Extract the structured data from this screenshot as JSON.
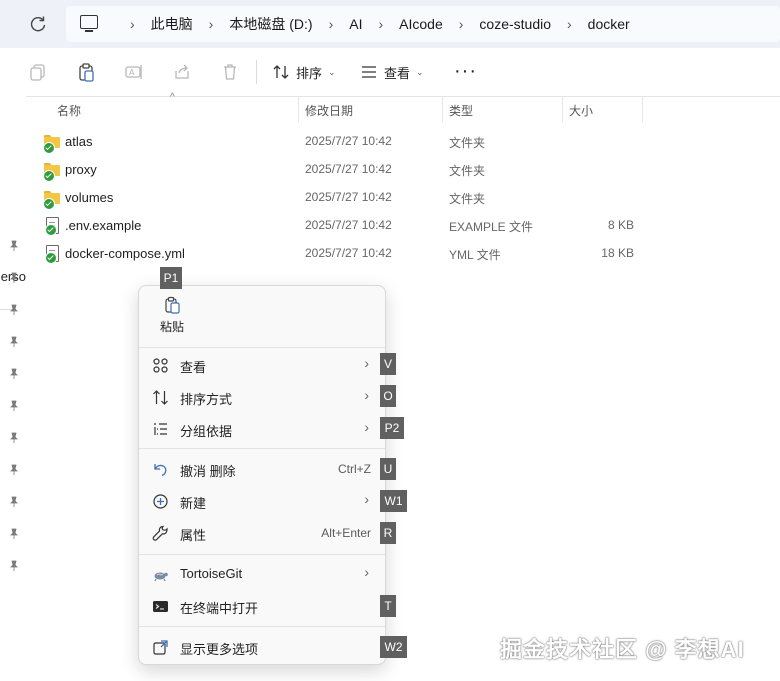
{
  "address_bar": {
    "refresh_icon": "refresh-icon",
    "pc_icon": "computer-icon",
    "crumbs": [
      "此电脑",
      "本地磁盘 (D:)",
      "AI",
      "AIcode",
      "coze-studio",
      "docker"
    ]
  },
  "toolbar": {
    "sort_label": "排序",
    "view_label": "查看",
    "more_label": "···"
  },
  "nav_pane": {
    "truncated_text": "erso"
  },
  "file_list": {
    "columns": [
      "名称",
      "修改日期",
      "类型",
      "大小"
    ],
    "rows": [
      {
        "name": "atlas",
        "date": "2025/7/27 10:42",
        "type": "文件夹",
        "size": "",
        "icon": "folder-icon"
      },
      {
        "name": "proxy",
        "date": "2025/7/27 10:42",
        "type": "文件夹",
        "size": "",
        "icon": "folder-icon"
      },
      {
        "name": "volumes",
        "date": "2025/7/27 10:42",
        "type": "文件夹",
        "size": "",
        "icon": "folder-icon"
      },
      {
        "name": ".env.example",
        "date": "2025/7/27 10:42",
        "type": "EXAMPLE 文件",
        "size": "8 KB",
        "icon": "file-icon"
      },
      {
        "name": "docker-compose.yml",
        "date": "2025/7/27 10:42",
        "type": "YML 文件",
        "size": "18 KB",
        "icon": "file-icon"
      }
    ]
  },
  "context_menu": {
    "paste_label": "粘贴",
    "items": [
      {
        "label": "查看",
        "shortcut": "",
        "icon": "grid-view-icon"
      },
      {
        "label": "排序方式",
        "shortcut": "",
        "icon": "sort-icon"
      },
      {
        "label": "分组依据",
        "shortcut": "",
        "icon": "group-by-icon"
      },
      {
        "label": "撤消 删除",
        "shortcut": "Ctrl+Z",
        "icon": "undo-icon"
      },
      {
        "label": "新建",
        "shortcut": "",
        "icon": "new-plus-icon"
      },
      {
        "label": "属性",
        "shortcut": "Alt+Enter",
        "icon": "wrench-icon"
      },
      {
        "label": "TortoiseGit",
        "shortcut": "",
        "icon": "tortoisegit-icon"
      },
      {
        "label": "在终端中打开",
        "shortcut": "",
        "icon": "terminal-icon"
      },
      {
        "label": "显示更多选项",
        "shortcut": "",
        "icon": "more-options-icon"
      }
    ]
  },
  "keytips": [
    "P1",
    "V",
    "O",
    "P2",
    "U",
    "W1",
    "R",
    "T",
    "W2"
  ],
  "watermark": "掘金技术社区 @ 李想AI"
}
